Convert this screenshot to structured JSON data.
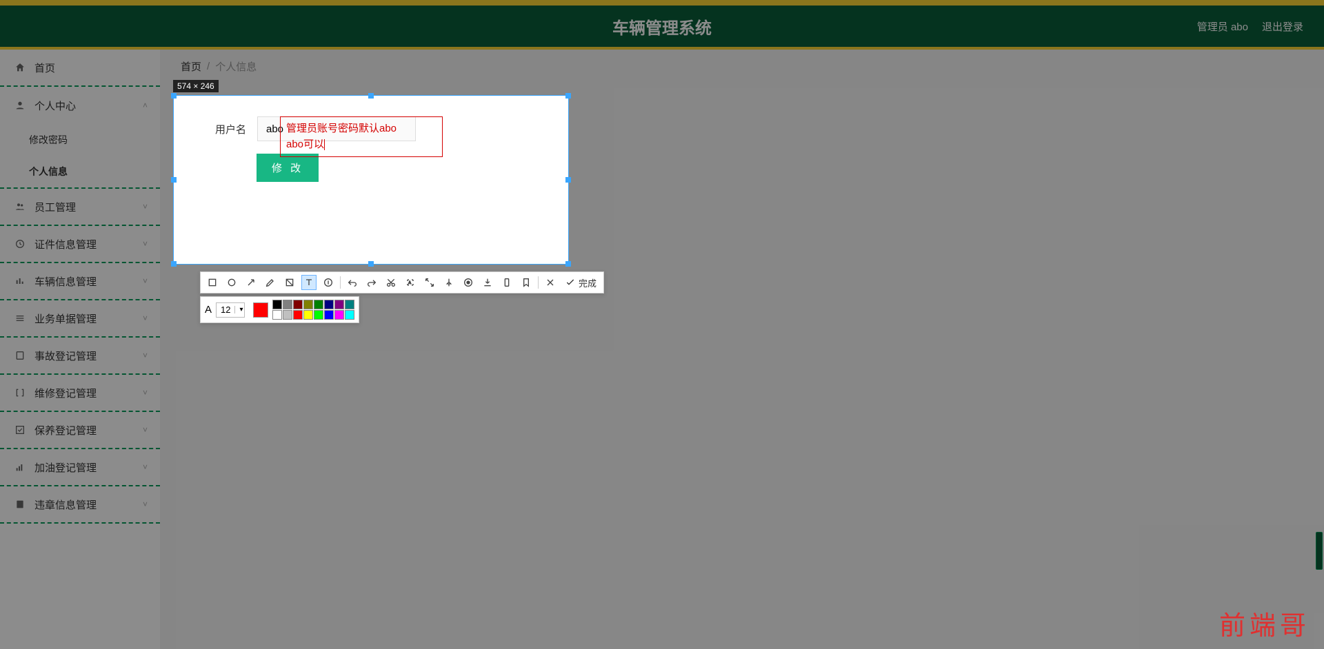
{
  "header": {
    "title": "车辆管理系统",
    "user": "管理员 abo",
    "logout": "退出登录"
  },
  "sidebar": {
    "home": "首页",
    "personal": "个人中心",
    "sub_pwd": "修改密码",
    "sub_info": "个人信息",
    "staff": "员工管理",
    "cert": "证件信息管理",
    "vehicle": "车辆信息管理",
    "biz": "业务单据管理",
    "accident": "事故登记管理",
    "repair": "维修登记管理",
    "maint": "保养登记管理",
    "fuel": "加油登记管理",
    "violation": "违章信息管理"
  },
  "breadcrumb": {
    "home": "首页",
    "current": "个人信息"
  },
  "form": {
    "label_user": "用户名",
    "value_user": "abo",
    "btn_modify": "修 改"
  },
  "annotation": {
    "line1": "管理员账号密码默认abo",
    "line2": "abo可以"
  },
  "capture": {
    "size": "574 × 246"
  },
  "toolbar": {
    "done": "完成",
    "fontsize": "12"
  },
  "palette_row1": [
    "#000000",
    "#808080",
    "#800000",
    "#808000",
    "#008000",
    "#000080",
    "#800080",
    "#008080"
  ],
  "palette_row2": [
    "#ffffff",
    "#c0c0c0",
    "#ff0000",
    "#ffff00",
    "#00ff00",
    "#0000ff",
    "#ff00ff",
    "#00ffff"
  ],
  "watermark": "前端哥"
}
